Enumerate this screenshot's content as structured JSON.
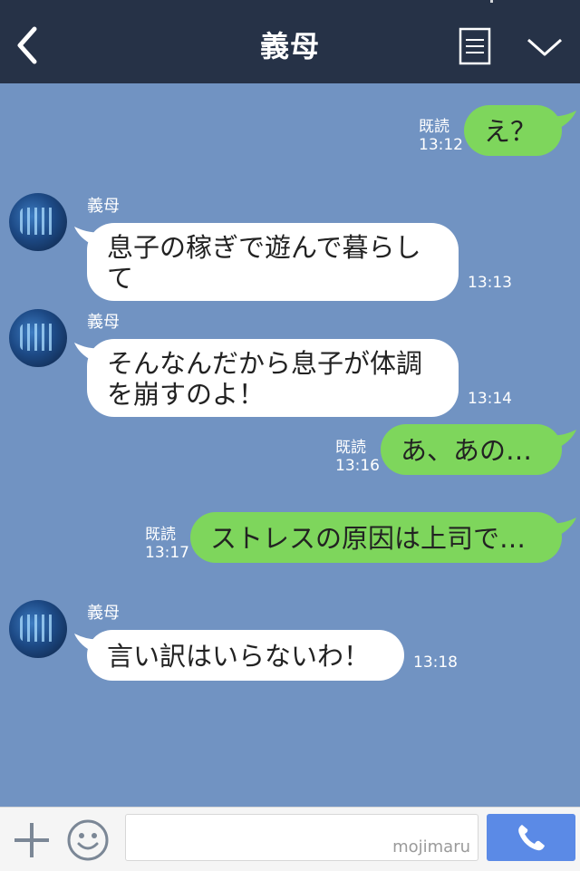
{
  "header": {
    "title": "義母"
  },
  "messages": [
    {
      "read": "既読",
      "time": "13:12",
      "text": "え？"
    },
    {
      "sender": "義母",
      "time": "13:13",
      "line1": "息子の稼ぎで遊んで暮らし",
      "line2": "て"
    },
    {
      "sender": "義母",
      "time": "13:14",
      "line1": "そんなんだから息子が体調",
      "line2": "を崩すのよ！"
    },
    {
      "read": "既読",
      "time": "13:16",
      "text": "あ、あの…"
    },
    {
      "read": "既読",
      "time": "13:17",
      "text": "ストレスの原因は上司で…"
    },
    {
      "sender": "義母",
      "time": "13:18",
      "text": "言い訳はいらないわ！"
    }
  ],
  "input": {
    "watermark": "mojimaru"
  },
  "colors": {
    "header_bg": "#263247",
    "chat_bg": "#7193c2",
    "outgoing_bubble": "#7ed65c",
    "incoming_bubble": "#ffffff",
    "call_button": "#5b8ae6"
  },
  "icons": [
    "back-arrow-icon",
    "menu-icon",
    "chevron-down-icon",
    "plus-icon",
    "emoji-icon",
    "phone-icon"
  ]
}
